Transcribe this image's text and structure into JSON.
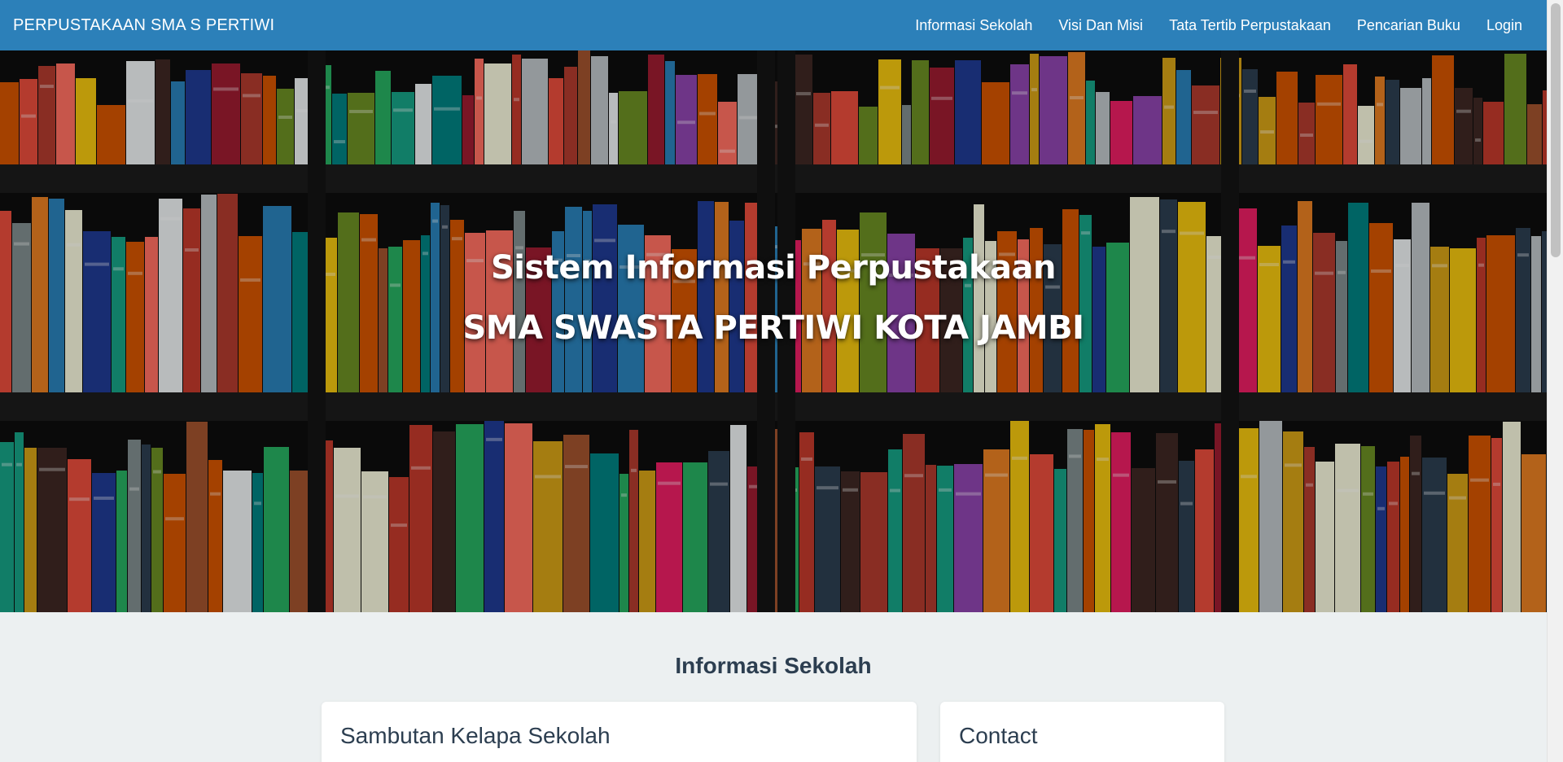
{
  "navbar": {
    "brand": "PERPUSTAKAAN SMA S PERTIWI",
    "links": [
      {
        "label": "Informasi Sekolah"
      },
      {
        "label": "Visi Dan Misi"
      },
      {
        "label": "Tata Tertib Perpustakaan"
      },
      {
        "label": "Pencarian Buku"
      },
      {
        "label": "Login"
      }
    ]
  },
  "hero": {
    "title": "Sistem Informasi Perpustakaan",
    "subtitle": "SMA SWASTA PERTIWI KOTA JAMBI"
  },
  "section": {
    "title": "Informasi Sekolah",
    "cards": [
      {
        "title": "Sambutan Kelapa Sekolah"
      },
      {
        "title": "Contact"
      }
    ]
  },
  "colors": {
    "navbar_bg": "#2c80b9",
    "page_bg": "#ecf0f1",
    "heading_text": "#2c3e50"
  }
}
